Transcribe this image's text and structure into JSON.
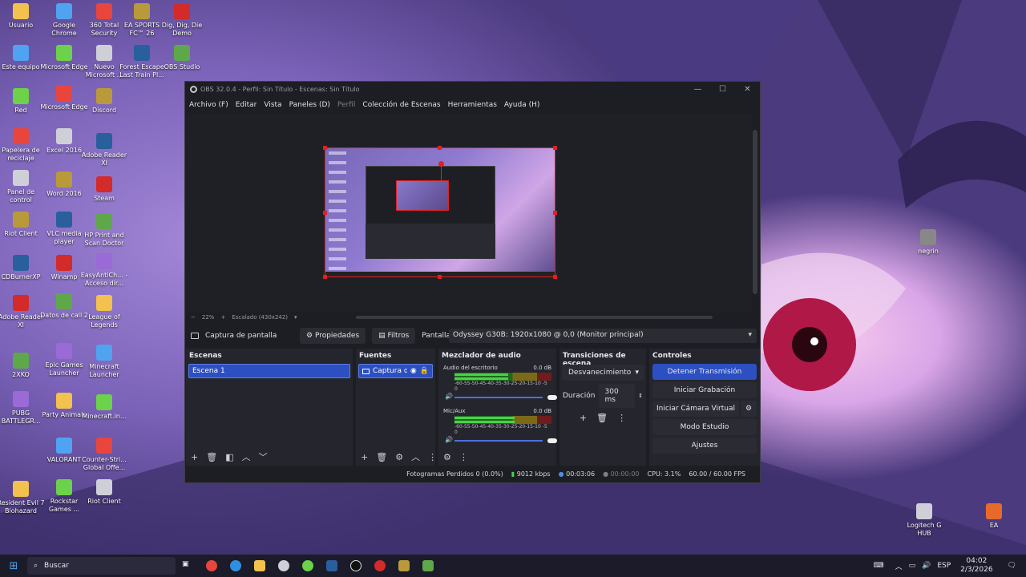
{
  "desktop": {
    "col1": [
      "Usuario",
      "Este equipo",
      "Red",
      "Papelera de reciclaje",
      "Panel de control",
      "Riot Client",
      "CDBurnerXP",
      "Adobe Reader XI",
      "2XKO",
      "PUBG BATTLEGR...",
      "Resident Evil 7 Biohazard"
    ],
    "col2": [
      "Google Chrome",
      "Microsoft Edge",
      "Microsoft Edge",
      "Excel 2016",
      "Word 2016",
      "VLC media player",
      "Winamp",
      "Datos de call 2",
      "Epic Games Launcher",
      "Party Animals",
      "VALORANT",
      "Rockstar Games ..."
    ],
    "col3": [
      "360 Total Security",
      "Nuevo Microsoft ...",
      "Discord",
      "Adobe Reader XI",
      "Steam",
      "HP Print and Scan Doctor",
      "EasyAntiCh... - Acceso dir...",
      "League of Legends",
      "Minecraft Launcher",
      "Minecraft.in...",
      "Counter-Stri... Global Offe...",
      "Riot Client"
    ],
    "col4": [
      "EA SPORTS FC™ 26",
      "Forest Escape Last Train Pl..."
    ],
    "col5": [
      "Dig, Dig, Die Demo",
      "OBS Studio"
    ],
    "right": [
      "negrin",
      "Logitech G HUB",
      "EA"
    ]
  },
  "obs": {
    "title": "OBS 32.0.4 - Perfil: Sin Título - Escenas: Sin Título",
    "menu": [
      "Archivo (F)",
      "Editar",
      "Vista",
      "Paneles (D)",
      "Perfil",
      "Colección de Escenas",
      "Herramientas",
      "Ayuda (H)"
    ],
    "zoom": "22%",
    "scale": "Escalado (430x242)",
    "source_name": "Captura de pantalla",
    "properties": "Propiedades",
    "filters": "Filtros",
    "screen_label": "Pantalla",
    "screen_value": "Odyssey G30B: 1920x1080 @ 0,0 (Monitor principal)",
    "scenes": {
      "title": "Escenas",
      "items": [
        "Escena 1"
      ]
    },
    "sources": {
      "title": "Fuentes",
      "items": [
        "Captura d"
      ]
    },
    "mixer": {
      "title": "Mezclador de audio",
      "channels": [
        {
          "name": "Audio del escritorio",
          "db": "0.0 dB",
          "level": 0.55
        },
        {
          "name": "Mic/Aux",
          "db": "0.0 dB",
          "level": 0.62
        }
      ],
      "ticks": "-60-55-50-45-40-35-30-25-20-15-10 -5 0"
    },
    "transitions": {
      "title": "Transiciones de escena",
      "type": "Desvanecimiento",
      "duration_label": "Duración",
      "duration": "300 ms"
    },
    "controls": {
      "title": "Controles",
      "buttons": [
        "Detener Transmisión",
        "Iniciar Grabación",
        "Iniciar Cámara Virtual",
        "Modo Estudio",
        "Ajustes"
      ]
    },
    "status": {
      "dropped": "Fotogramas Perdidos 0 (0.0%)",
      "bitrate": "9012 kbps",
      "stream_time": "00:03:06",
      "rec_time": "00:00:00",
      "cpu": "CPU: 3.1%",
      "fps": "60.00 / 60.00 FPS"
    }
  },
  "taskbar": {
    "search": "Buscar",
    "lang": "ESP",
    "time": "04:02",
    "date": "2/3/2026"
  }
}
